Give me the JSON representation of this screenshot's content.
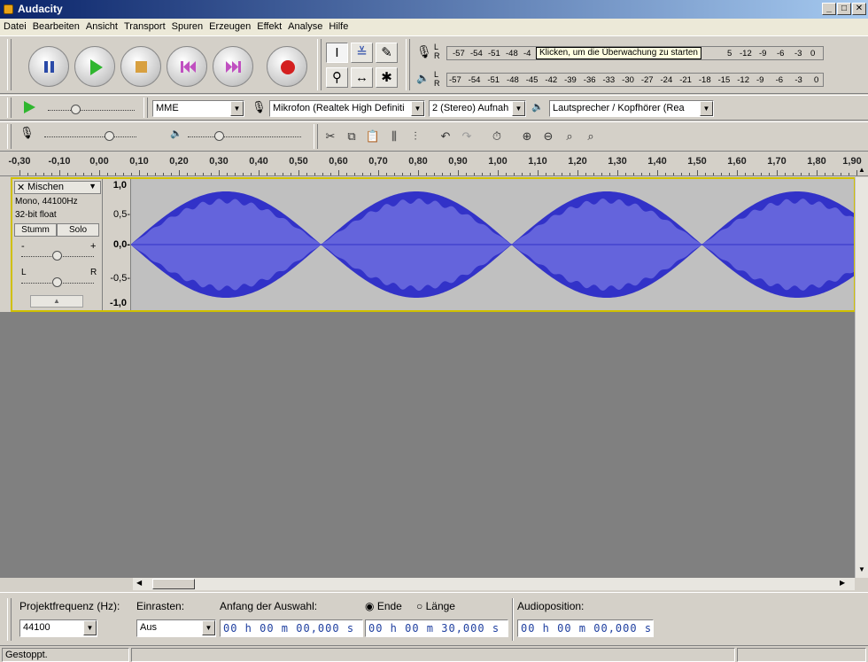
{
  "window": {
    "title": "Audacity"
  },
  "menu": [
    "Datei",
    "Bearbeiten",
    "Ansicht",
    "Transport",
    "Spuren",
    "Erzeugen",
    "Effekt",
    "Analyse",
    "Hilfe"
  ],
  "meters": {
    "record_ticks": [
      "-57",
      "-54",
      "-51",
      "-48",
      "-4"
    ],
    "record_hint": "Klicken, um die Überwachung zu starten",
    "record_ticks_right": [
      "5",
      "-12",
      "-9",
      "-6",
      "-3",
      "0"
    ],
    "play_ticks": [
      "-57",
      "-54",
      "-51",
      "-48",
      "-45",
      "-42",
      "-39",
      "-36",
      "-33",
      "-30",
      "-27",
      "-24",
      "-21",
      "-18",
      "-15",
      "-12",
      "-9",
      "-6",
      "-3",
      "0"
    ],
    "lr_label_l": "L",
    "lr_label_r": "R"
  },
  "device": {
    "host": "MME",
    "input": "Mikrofon (Realtek High Definiti",
    "channels": "2 (Stereo) Aufnah",
    "output": "Lautsprecher / Kopfhörer (Rea"
  },
  "ruler": {
    "ticks": [
      "-0,30",
      "-0,10",
      "0,00",
      "0,10",
      "0,20",
      "0,30",
      "0,40",
      "0,50",
      "0,60",
      "0,70",
      "0,80",
      "0,90",
      "1,00",
      "1,10",
      "1,20",
      "1,30",
      "1,40",
      "1,50",
      "1,60",
      "1,70",
      "1,80",
      "1,90"
    ]
  },
  "track": {
    "name": "Mischen",
    "close": "✕",
    "info1": "Mono, 44100Hz",
    "info2": "32-bit float",
    "mute": "Stumm",
    "solo": "Solo",
    "gain_minus": "-",
    "gain_plus": "+",
    "pan_l": "L",
    "pan_r": "R",
    "scale": [
      "1,0",
      "0,5-",
      "0,0-",
      "-0,5-",
      "-1,0"
    ],
    "wave_color": "#3232c8",
    "wave_light": "#6464dc"
  },
  "selection": {
    "rate_label": "Projektfrequenz (Hz):",
    "rate_value": "44100",
    "snap_label": "Einrasten:",
    "snap_value": "Aus",
    "start_label": "Anfang der Auswahl:",
    "end_option": "Ende",
    "length_option": "Länge",
    "position_label": "Audioposition:",
    "start_time": "00 h 00 m 00,000 s",
    "end_time": "00 h 00 m 30,000 s",
    "position_time": "00 h 00 m 00,000 s"
  },
  "status": {
    "text": "Gestoppt."
  }
}
